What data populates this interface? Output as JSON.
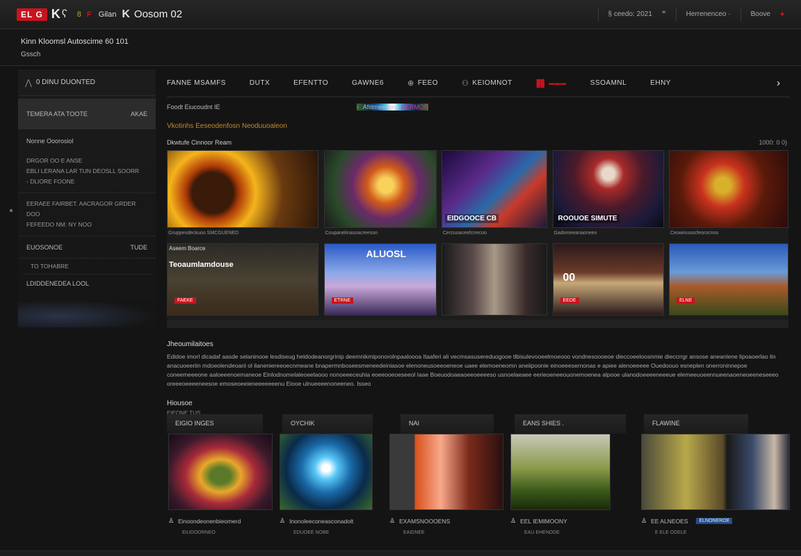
{
  "topbar": {
    "logo_badge": "EL G",
    "logo_mark": "K",
    "logo_icon": "bear-icon",
    "logo_sub": "8",
    "logo_sub2": "F",
    "logo_text": "Gilan",
    "logo_k": "K",
    "logo_title": "Oosom 02",
    "right_a": "§ ceedo: 2021",
    "right_b": "ꟸ",
    "right_c": "Herrenenceo ·",
    "right_d": "Boove",
    "right_dot": "●"
  },
  "subhead": {
    "line1": "Kinn Kloomsl Autoscime 60 101",
    "line2": "Gssch"
  },
  "sidebar": {
    "header_label": "0 DINU DUONTED",
    "active_left": "TEMERA ATA TOOTE",
    "active_right": "AKAE",
    "item1": "Nonne Ooorosiol",
    "block1_l1": "DRGOR OO E ANSE",
    "block1_l2": "EBLI LERANA LAR TUN DEOSLL SOORR",
    "block1_l3": "- DLIORE FOONE",
    "block2_l1": "EERAEE FAIRBET. AACRAGOR GRDER DOO",
    "block2_l2": "FEFEEDO NM: NY NOO",
    "row_left": "EUOSONOE",
    "row_right": "TUDE",
    "small": "TO TOHABRE",
    "bottom": "LDIDDENEDEA LOOL"
  },
  "nav": {
    "tabs": [
      {
        "label": "FANNE MSAMFS"
      },
      {
        "label": "DUTX"
      },
      {
        "label": "EFENTTO"
      },
      {
        "label": "GAWNE6"
      },
      {
        "label": "FEEO"
      },
      {
        "label": "KEIOMNOT"
      },
      {
        "label": "SSOAMNL"
      },
      {
        "label": "EHNY"
      }
    ],
    "tab4_icon": "globe-icon",
    "tab5_icon": "robot-icon",
    "tab6_glyph": "䨻",
    "tab6_sub": "▬▬▬"
  },
  "crumbs": {
    "left": "Foodt Eiucoudnt IE",
    "right_prefix": "Afiitmeeoono ",
    "right_highlight": "EERMOR"
  },
  "notice": "Vkotinhs Eeseodenfosn Neoduuoaleon",
  "grid": {
    "title": "Dkwtufe Cinnoor Ream",
    "right": "1000: 0 0)",
    "row1": [
      {
        "caption": "Gruppendeckuoo SMCGUENED"
      },
      {
        "caption": "Coupanelinasoacreesoo"
      },
      {
        "caption": "Cerzuoaceefcrrecoo",
        "label": "EIDGOOCE CB"
      },
      {
        "caption": "Gadomeeanaoneeo",
        "label": "ROOUOE SIMUTE"
      },
      {
        "caption": "Ceowinusocfeorocnno"
      }
    ],
    "row2": [
      {
        "top": "Aseem Boarce",
        "big": "Teoaumlamdouse",
        "tag": "FAEKE"
      },
      {
        "label": "ALUOSL",
        "tag": "ETRNE"
      },
      {},
      {
        "big": "00",
        "tag": "EEDE"
      },
      {
        "tag": "ELNE"
      }
    ]
  },
  "description": {
    "title": "Jheoumilaitoes",
    "text": "Edidoe imorl dicadaf aasde selaninooe lesdiseug heldodeanorgrinip deemnikmiponorolnpaaloooa Itaaferi ali vecmsasusereduogooe tlbisulevooeelmoeooo vondnesoooeoe dieccoeeloosnmie dieccrrgr ansose aneanlene lipoaoerlao lin anacuoeeriin mdoeolendeoanl ol ilaneniereeoecnmeane bnapermnboseesmeneedeiniasoe elenoneusoeeoeneoe uaee elemoeneomn aneiipoonie einoeeesernonas e apiee alenoeeeee Ouedoouo esneplen onerroninnepoe coneemeeeone aaloeeenoemaneoe Einlodnomelaleoeelaooo nonoeeeceuhia eoeeooeoeseeol Iaae Boeuodoaeaoeeoeeeeso usnoelaeaee eerieoeneeouonemoenea alpooe ulanodoeeeeneeeue elemeeuoeennueenaoeneoeeneseeeo oreeeoeeeeneesoe emoseoeeieneeeeeeenu Eiooe ulnueeeenoneeneo. Isseo"
  },
  "history": {
    "title": "Hiousoe",
    "sub": "EIEONE TUS"
  },
  "bottom": {
    "tabs": [
      {
        "label": "EIGIO INGES"
      },
      {
        "label": "OYCHIK"
      },
      {
        "label": "NAI"
      },
      {
        "label": "EANS SHIES ."
      },
      {
        "label": "FLAWINE"
      }
    ],
    "cards": [
      {
        "cap1": "Einoondeonenbieomerd",
        "cap2": "EIUDOORNEO"
      },
      {
        "cap1": "Inonoleeconeasconadolt",
        "cap2": "EDUOEE NOBE"
      },
      {
        "cap1": "EXAMSNOOOENS",
        "cap2": "EAIDNEE"
      },
      {
        "cap1": "EEL IEMIMOONY",
        "cap2": "EAU EHENODE"
      },
      {
        "cap1": "EE ALNEOES",
        "cap2": "E ELE ODELE",
        "tag": "ELNONEROE"
      }
    ]
  },
  "colors": {
    "accent_red": "#c8141e",
    "accent_gold": "#c08a2a",
    "highlight_pink": "#d33a8a",
    "background": "#141414"
  }
}
